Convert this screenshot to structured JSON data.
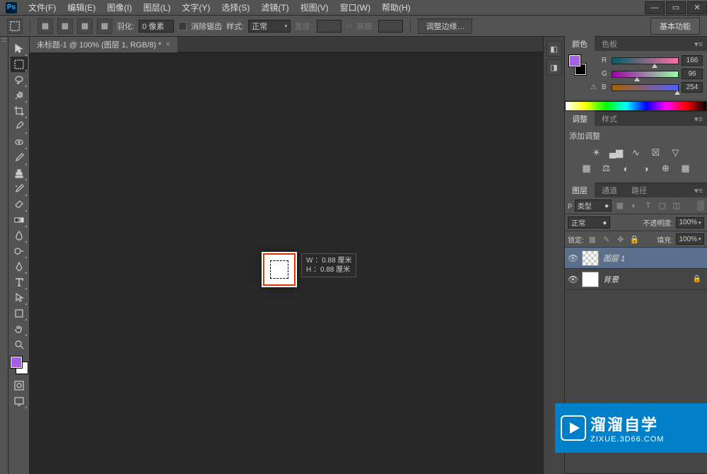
{
  "menu": [
    "文件(F)",
    "编辑(E)",
    "图像(I)",
    "图层(L)",
    "文字(Y)",
    "选择(S)",
    "滤镜(T)",
    "视图(V)",
    "窗口(W)",
    "帮助(H)"
  ],
  "options": {
    "feather_label": "羽化:",
    "feather_value": "0 像素",
    "antialias_label": "消除锯齿",
    "style_label": "样式:",
    "style_value": "正常",
    "width_label": "宽度:",
    "height_label": "高度:",
    "refine_edge": "调整边缘…",
    "essentials": "基本功能"
  },
  "doc_tab": {
    "title": "未标题-1 @ 100% (图层 1, RGB/8) *",
    "close": "×"
  },
  "tooltip": {
    "w": "W ：0.88 厘米",
    "h": "H ：0.88 厘米"
  },
  "color_panel": {
    "tabs": [
      "颜色",
      "色板"
    ],
    "fg": "#a660a6",
    "bg": "#000000",
    "channels": [
      {
        "label": "R",
        "value": "166",
        "pct": 65,
        "grad": "linear-gradient(to right,#006060,#ff6fa6)"
      },
      {
        "label": "G",
        "value": "96",
        "pct": 38,
        "grad": "linear-gradient(to right,#a200a6,#96ffa6)"
      },
      {
        "label": "B",
        "value": "254",
        "pct": 99,
        "grad": "linear-gradient(to right,#a66000,#5060ff)"
      }
    ]
  },
  "adjust_panel": {
    "tabs": [
      "调整",
      "样式"
    ],
    "title": "添加调整"
  },
  "layers_panel": {
    "tabs": [
      "图层",
      "通道",
      "路径"
    ],
    "filter_label": "类型",
    "blend_mode": "正常",
    "opacity_label": "不透明度:",
    "opacity_value": "100%",
    "lock_label": "锁定:",
    "fill_label": "填充:",
    "fill_value": "100%",
    "layers": [
      {
        "name": "图层 1",
        "checker": true,
        "active": true,
        "locked": false
      },
      {
        "name": "背景",
        "checker": false,
        "active": false,
        "locked": true
      }
    ]
  },
  "watermark": {
    "title": "溜溜自学",
    "sub": "ZIXUE.3D66.COM"
  },
  "fg_color": "#a660e6"
}
